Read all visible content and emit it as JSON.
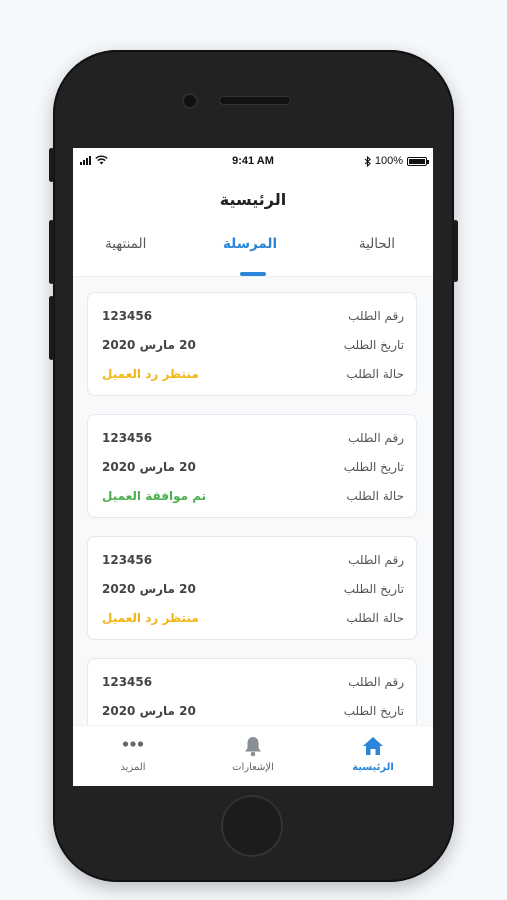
{
  "status_bar": {
    "time": "9:41 AM",
    "battery": "100%",
    "battery_level": 1.0
  },
  "header": {
    "title": "الرئيسية"
  },
  "tabs": [
    {
      "label": "الحالية",
      "active": false
    },
    {
      "label": "المرسلة",
      "active": true
    },
    {
      "label": "المنتهية",
      "active": false
    }
  ],
  "requests": [
    {
      "number_label": "رقم الطلب",
      "number": "123456",
      "date_label": "تاريخ الطلب",
      "date": "20 مارس 2020",
      "status_label": "حالة الطلب",
      "status": "منتظر رد العميل",
      "status_color": "#f2b516"
    },
    {
      "number_label": "رقم الطلب",
      "number": "123456",
      "date_label": "تاريخ الطلب",
      "date": "20 مارس 2020",
      "status_label": "حالة الطلب",
      "status": "تم موافقة العميل",
      "status_color": "#4caf50"
    },
    {
      "number_label": "رقم الطلب",
      "number": "123456",
      "date_label": "تاريخ الطلب",
      "date": "20 مارس 2020",
      "status_label": "حالة الطلب",
      "status": "منتظر رد العميل",
      "status_color": "#f2b516"
    },
    {
      "number_label": "رقم الطلب",
      "number": "123456",
      "date_label": "تاريخ الطلب",
      "date": "20 مارس 2020"
    }
  ],
  "bottom_nav": [
    {
      "label": "الرئيسية",
      "icon": "home-icon",
      "active": true
    },
    {
      "label": "الإشعارات",
      "icon": "bell-icon",
      "active": false
    },
    {
      "label": "المزيد",
      "icon": "more-icon",
      "active": false
    }
  ],
  "colors": {
    "accent": "#2b86d9",
    "pending": "#f2b516",
    "approved": "#4caf50"
  }
}
